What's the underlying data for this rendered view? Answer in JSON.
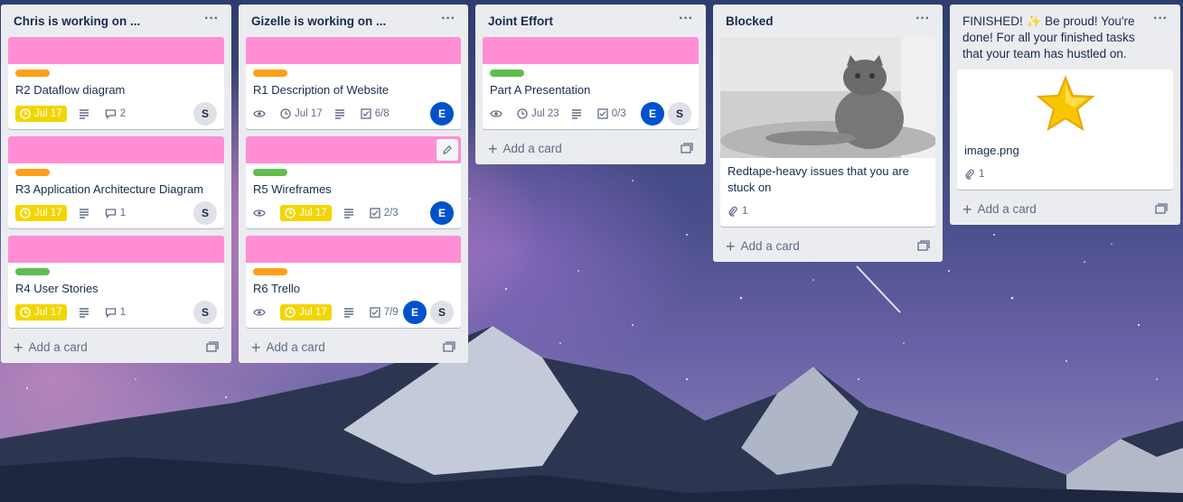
{
  "lists": [
    {
      "title": "Chris is working on ...",
      "cards": [
        {
          "title": "R2 Dataflow diagram",
          "due": "Jul 17",
          "comments": "2",
          "member": "S"
        },
        {
          "title": "R3 Application Architecture Diagram",
          "due": "Jul 17",
          "comments": "1",
          "member": "S"
        },
        {
          "title": "R4 User Stories",
          "due": "Jul 17",
          "comments": "1",
          "member": "S"
        }
      ],
      "add_label": "Add a card"
    },
    {
      "title": "Gizelle is working on ...",
      "cards": [
        {
          "title": "R1 Description of Website",
          "due": "Jul 17",
          "checklist": "6/8",
          "member": "E"
        },
        {
          "title": "R5 Wireframes",
          "due": "Jul 17",
          "checklist": "2/3",
          "member": "E"
        },
        {
          "title": "R6 Trello",
          "due": "Jul 17",
          "checklist": "7/9",
          "member1": "E",
          "member2": "S"
        }
      ],
      "add_label": "Add a card"
    },
    {
      "title": "Joint Effort",
      "cards": [
        {
          "title": "Part A Presentation",
          "due": "Jul 23",
          "checklist": "0/3",
          "member1": "E",
          "member2": "S"
        }
      ],
      "add_label": "Add a card"
    },
    {
      "title": "Blocked",
      "cards": [
        {
          "title": "Redtape-heavy issues that you are stuck on",
          "attachments": "1"
        }
      ],
      "add_label": "Add a card"
    },
    {
      "title": "FINISHED! ✨ Be proud! You're done! For all your finished tasks that your team has hustled on.",
      "cards": [
        {
          "title": "image.png",
          "attachments": "1"
        }
      ],
      "add_label": "Add a card"
    }
  ],
  "colors": {
    "cover_pink": "#ff8ed4",
    "label_orange": "#ff9f1a",
    "label_green": "#61bd4f",
    "due_yellow": "#f2d600",
    "avatar_blue": "#0052cc"
  }
}
